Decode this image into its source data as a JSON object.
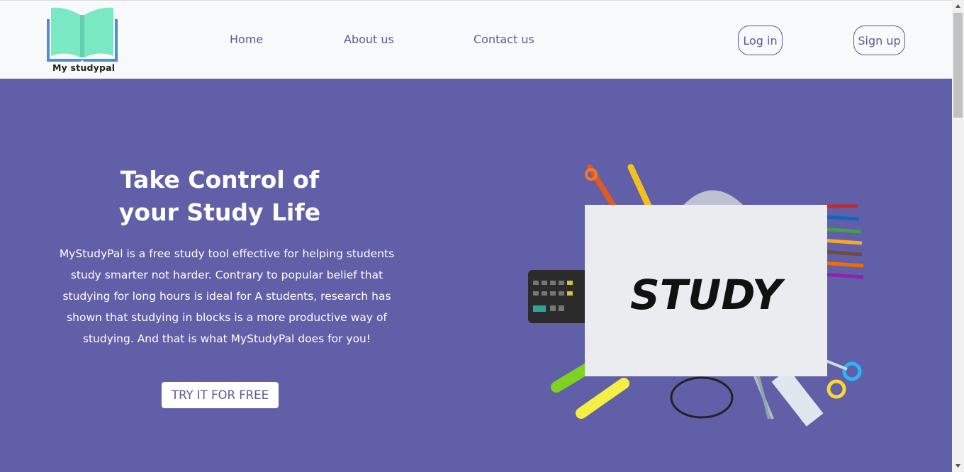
{
  "header": {
    "logo_text": "My studypal",
    "nav": {
      "home": "Home",
      "about": "About us",
      "contact": "Contact us"
    },
    "login_label": "Log in",
    "signup_label": "Sign up"
  },
  "hero": {
    "title_line1": "Take Control of",
    "title_line2": "your Study Life",
    "body_lines": [
      "MyStudyPal is a free study tool effective for helping students",
      "study smarter not harder. Contrary to popular belief that",
      "studying for long hours is ideal for A students, research has",
      "shown that studying in blocks is a more productive way of",
      "studying. And that is what MyStudyPal does for you!"
    ],
    "cta_label": "TRY IT FOR FREE",
    "image_card_text": "STUDY"
  },
  "colors": {
    "brand_purple": "#615fa8",
    "nav_text": "#5e5a92",
    "header_bg": "#f8f9fa"
  }
}
